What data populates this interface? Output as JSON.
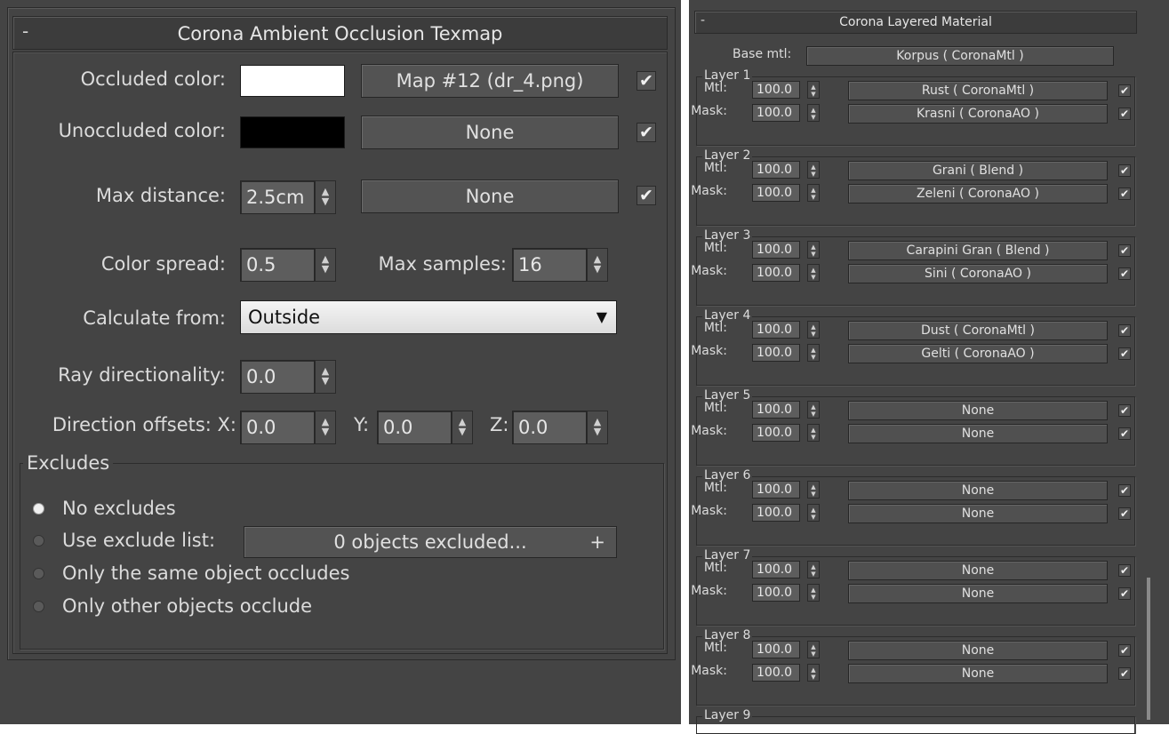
{
  "left": {
    "title": "Corona Ambient Occlusion Texmap",
    "collapse": "-",
    "occluded_label": "Occluded color:",
    "occluded_map": "Map #12 (dr_4.png)",
    "unoccluded_label": "Unoccluded color:",
    "unoccluded_map": "None",
    "maxdist_label": "Max distance:",
    "maxdist_value": "2.5cm",
    "maxdist_map": "None",
    "spread_label": "Color spread:",
    "spread_value": "0.5",
    "samples_label": "Max samples:",
    "samples_value": "16",
    "calc_label": "Calculate from:",
    "calc_value": "Outside",
    "ray_label": "Ray directionality:",
    "ray_value": "0.0",
    "offsets_label": "Direction offsets: X:",
    "offset_x": "0.0",
    "offset_y_label": "Y:",
    "offset_y": "0.0",
    "offset_z_label": "Z:",
    "offset_z": "0.0",
    "excludes_title": "Excludes",
    "opt_no": "No excludes",
    "opt_list": "Use exclude list:",
    "exclude_btn": "0 objects excluded...",
    "exclude_plus": "+",
    "opt_same": "Only the same object occludes",
    "opt_other": "Only other objects occlude",
    "colors": {
      "occluded": "#ffffff",
      "unoccluded": "#000000"
    }
  },
  "right": {
    "title": "Corona Layered Material",
    "collapse": "-",
    "base_label": "Base mtl:",
    "base_value": "Korpus  ( CoronaMtl )",
    "mtl_label": "Mtl:",
    "mask_label": "Mask:",
    "layers": [
      {
        "title": "Layer 1",
        "mtl_amt": "100.0",
        "mtl": "Rust  ( CoronaMtl )",
        "mask_amt": "100.0",
        "mask": "Krasni  ( CoronaAO )"
      },
      {
        "title": "Layer 2",
        "mtl_amt": "100.0",
        "mtl": "Grani  ( Blend )",
        "mask_amt": "100.0",
        "mask": "Zeleni  ( CoronaAO )"
      },
      {
        "title": "Layer 3",
        "mtl_amt": "100.0",
        "mtl": "Carapini Gran  ( Blend )",
        "mask_amt": "100.0",
        "mask": "Sini  ( CoronaAO )"
      },
      {
        "title": "Layer 4",
        "mtl_amt": "100.0",
        "mtl": "Dust  ( CoronaMtl )",
        "mask_amt": "100.0",
        "mask": "Gelti  ( CoronaAO )"
      },
      {
        "title": "Layer 5",
        "mtl_amt": "100.0",
        "mtl": "None",
        "mask_amt": "100.0",
        "mask": "None"
      },
      {
        "title": "Layer 6",
        "mtl_amt": "100.0",
        "mtl": "None",
        "mask_amt": "100.0",
        "mask": "None"
      },
      {
        "title": "Layer 7",
        "mtl_amt": "100.0",
        "mtl": "None",
        "mask_amt": "100.0",
        "mask": "None"
      },
      {
        "title": "Layer 8",
        "mtl_amt": "100.0",
        "mtl": "None",
        "mask_amt": "100.0",
        "mask": "None"
      }
    ],
    "layer9_title": "Layer 9"
  }
}
